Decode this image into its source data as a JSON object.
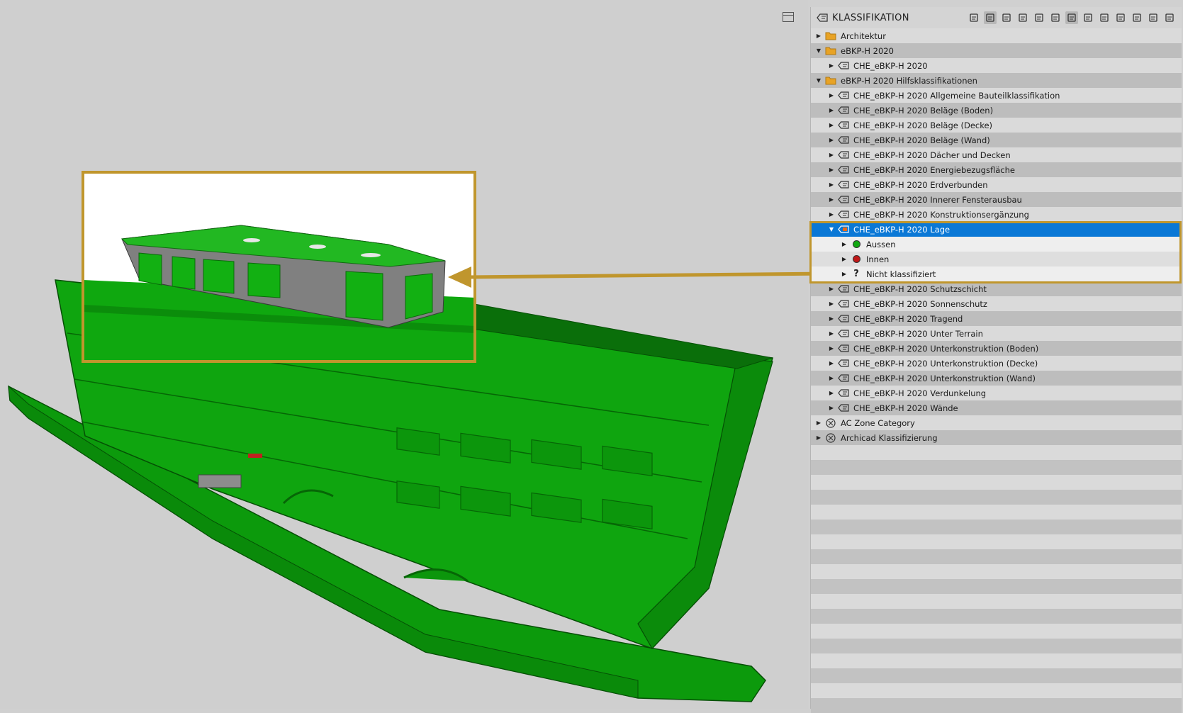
{
  "panel": {
    "title": "KLASSIFIKATION",
    "toolbar": [
      "hierarchy-icon",
      "tree-icon",
      "new-document-icon",
      "new-item-icon",
      "open-folder-icon",
      "delete-icon",
      "visibility-icon",
      "settings-icon",
      "edit-icon",
      "import-icon",
      "export-icon",
      "library-icon",
      "window-icon"
    ]
  },
  "tree": [
    {
      "label": "Architektur",
      "level": 0,
      "icon": "folder-icon",
      "expanded": false
    },
    {
      "label": "eBKP-H 2020",
      "level": 0,
      "icon": "folder-icon",
      "expanded": true
    },
    {
      "label": "CHE_eBKP-H 2020",
      "level": 1,
      "icon": "classification-icon",
      "expanded": false
    },
    {
      "label": "eBKP-H 2020 Hilfsklassifikationen",
      "level": 0,
      "icon": "folder-icon",
      "expanded": true
    },
    {
      "label": "CHE_eBKP-H 2020 Allgemeine Bauteilklassifikation",
      "level": 1,
      "icon": "classification-icon",
      "expanded": false
    },
    {
      "label": "CHE_eBKP-H 2020 Beläge (Boden)",
      "level": 1,
      "icon": "classification-icon",
      "expanded": false
    },
    {
      "label": "CHE_eBKP-H 2020 Beläge (Decke)",
      "level": 1,
      "icon": "classification-icon",
      "expanded": false
    },
    {
      "label": "CHE_eBKP-H 2020 Beläge (Wand)",
      "level": 1,
      "icon": "classification-icon",
      "expanded": false
    },
    {
      "label": "CHE_eBKP-H 2020 Dächer und Decken",
      "level": 1,
      "icon": "classification-icon",
      "expanded": false
    },
    {
      "label": "CHE_eBKP-H 2020 Energiebezugsfläche",
      "level": 1,
      "icon": "classification-icon",
      "expanded": false
    },
    {
      "label": "CHE_eBKP-H 2020 Erdverbunden",
      "level": 1,
      "icon": "classification-icon",
      "expanded": false
    },
    {
      "label": "CHE_eBKP-H 2020 Innerer Fensterausbau",
      "level": 1,
      "icon": "classification-icon",
      "expanded": false
    },
    {
      "label": "CHE_eBKP-H 2020 Konstruktionsergänzung",
      "level": 1,
      "icon": "classification-icon",
      "expanded": false
    },
    {
      "label": "CHE_eBKP-H 2020 Lage",
      "level": 1,
      "icon": "classification-icon",
      "expanded": true,
      "selected": true
    },
    {
      "label": "Aussen",
      "level": 2,
      "icon": "green-dot-icon",
      "color": "#12a812",
      "expanded": false
    },
    {
      "label": "Innen",
      "level": 2,
      "icon": "red-dot-icon",
      "color": "#c01818",
      "expanded": false
    },
    {
      "label": "Nicht klassifiziert",
      "level": 2,
      "icon": "question-icon",
      "expanded": false
    },
    {
      "label": "CHE_eBKP-H 2020 Schutzschicht",
      "level": 1,
      "icon": "classification-icon",
      "expanded": false
    },
    {
      "label": "CHE_eBKP-H 2020 Sonnenschutz",
      "level": 1,
      "icon": "classification-icon",
      "expanded": false
    },
    {
      "label": "CHE_eBKP-H 2020 Tragend",
      "level": 1,
      "icon": "classification-icon",
      "expanded": false
    },
    {
      "label": "CHE_eBKP-H 2020 Unter Terrain",
      "level": 1,
      "icon": "classification-icon",
      "expanded": false
    },
    {
      "label": "CHE_eBKP-H 2020 Unterkonstruktion (Boden)",
      "level": 1,
      "icon": "classification-icon",
      "expanded": false
    },
    {
      "label": "CHE_eBKP-H 2020 Unterkonstruktion (Decke)",
      "level": 1,
      "icon": "classification-icon",
      "expanded": false
    },
    {
      "label": "CHE_eBKP-H 2020 Unterkonstruktion (Wand)",
      "level": 1,
      "icon": "classification-icon",
      "expanded": false
    },
    {
      "label": "CHE_eBKP-H 2020 Verdunkelung",
      "level": 1,
      "icon": "classification-icon",
      "expanded": false
    },
    {
      "label": "CHE_eBKP-H 2020 Wände",
      "level": 1,
      "icon": "classification-icon",
      "expanded": false
    },
    {
      "label": "AC Zone Category",
      "level": 0,
      "icon": "system-classification-icon",
      "expanded": false
    },
    {
      "label": "Archicad Klassifizierung",
      "level": 0,
      "icon": "system-classification-icon",
      "expanded": false
    }
  ],
  "colors": {
    "accent": "#c0962d",
    "selection": "#0a78d6",
    "model_green": "#11a511"
  }
}
